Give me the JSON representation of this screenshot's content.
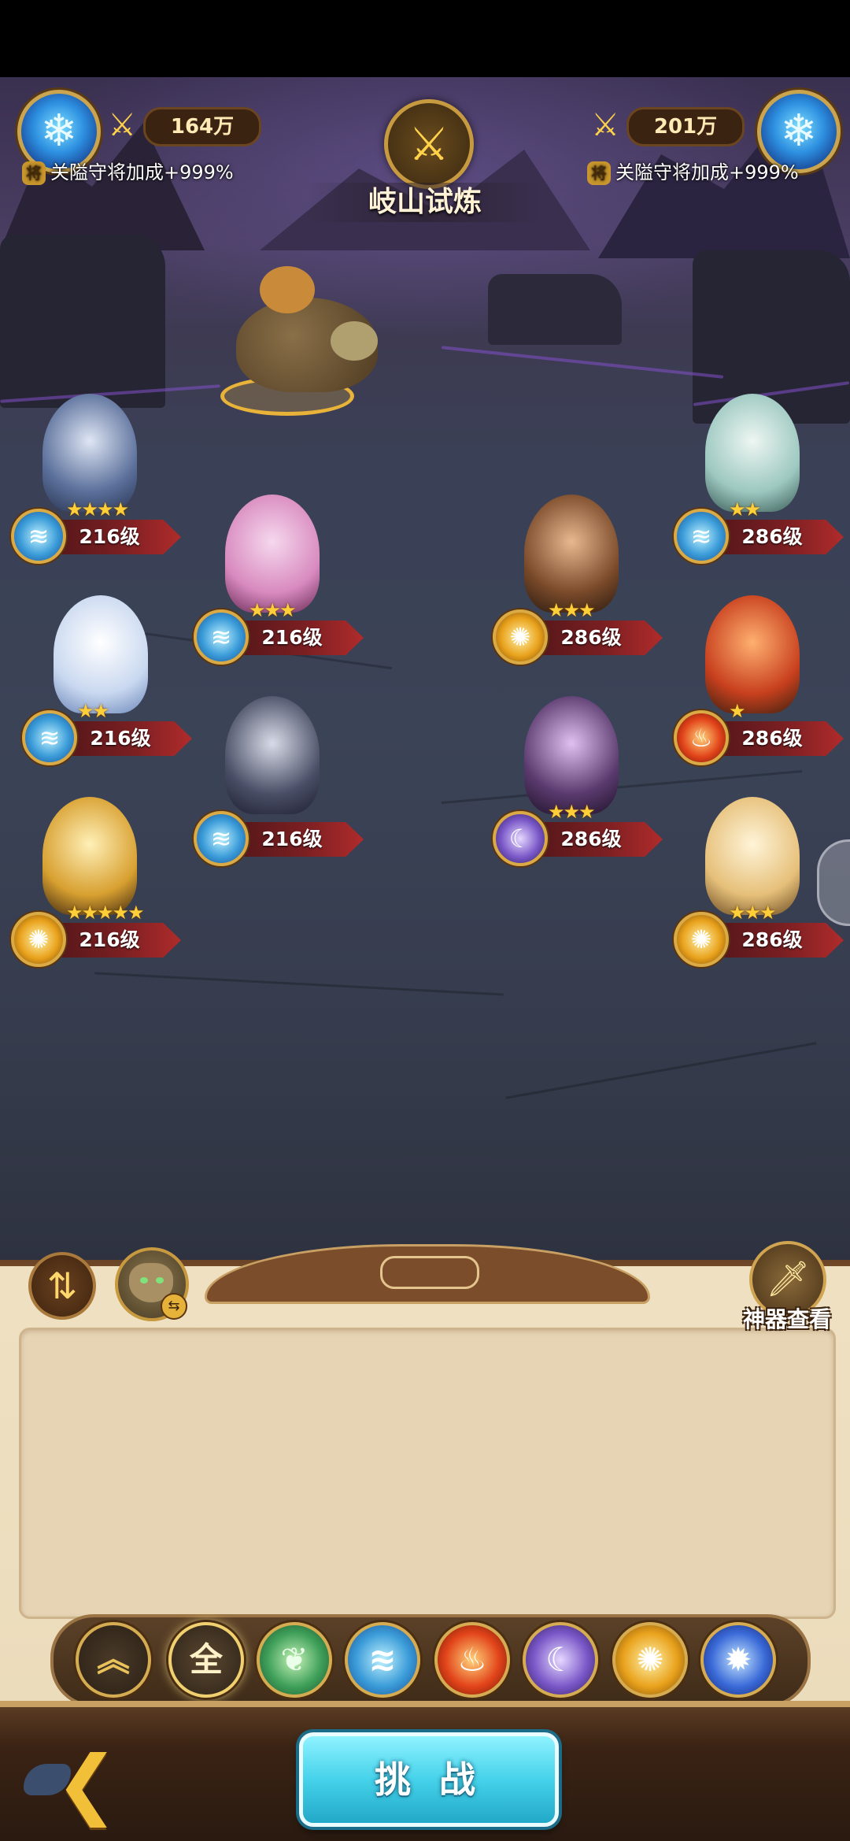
{
  "hud": {
    "left": {
      "power": "164万",
      "bonus": "关隘守将加成+999%"
    },
    "right": {
      "power": "201万",
      "bonus": "关隘守将加成+999%"
    },
    "stage_title": "岐山试炼"
  },
  "player_team": [
    {
      "level": "216级",
      "stars": "★★★★",
      "element": "water"
    },
    {
      "level": "216级",
      "stars": "★★★",
      "element": "water"
    },
    {
      "level": "216级",
      "stars": "★★",
      "element": "water"
    },
    {
      "level": "216级",
      "stars": "",
      "element": "water"
    },
    {
      "level": "216级",
      "stars": "★★★★★",
      "element": "sun"
    }
  ],
  "enemy_team": [
    {
      "level": "286级",
      "stars": "★★",
      "element": "water"
    },
    {
      "level": "286级",
      "stars": "★★★",
      "element": "sun"
    },
    {
      "level": "286级",
      "stars": "★",
      "element": "fire"
    },
    {
      "level": "286级",
      "stars": "★★★",
      "element": "moon"
    },
    {
      "level": "286级",
      "stars": "★★★",
      "element": "sun"
    }
  ],
  "panel": {
    "artifact_label": "神器查看",
    "filters": {
      "all_label": "全"
    }
  },
  "actions": {
    "challenge_label": "挑 战"
  },
  "icons": {
    "emblem": "snowflake-crystal-icon",
    "power": "crossed-swords-icon",
    "swap": "swap-arrows-icon",
    "back": "back-arrow-icon",
    "artifact": "sword-artifact-icon"
  }
}
